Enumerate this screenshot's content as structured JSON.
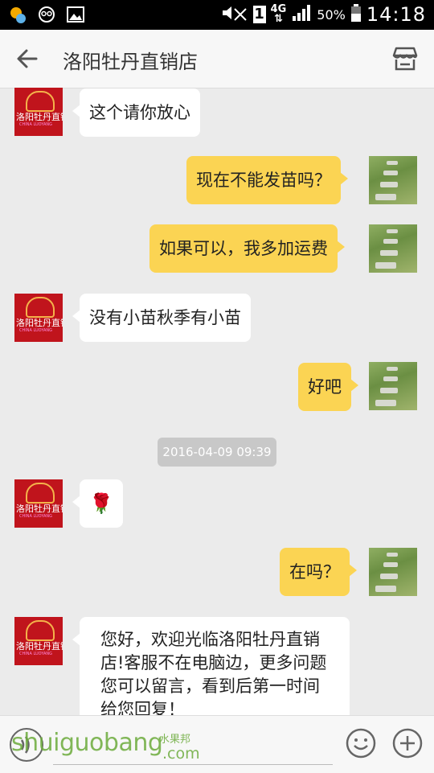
{
  "status_bar": {
    "network": "4G",
    "sim_slot": "1",
    "battery": "50%",
    "time": "14:18"
  },
  "app_bar": {
    "title": "洛阳牡丹直销店",
    "icons": {
      "back": "back-arrow-icon",
      "shop": "store-icon"
    }
  },
  "avatar_shop": {
    "logo_text": "洛阳牡丹直销店",
    "logo_en": "CHINA LUOYANG"
  },
  "messages": [
    {
      "side": "in",
      "text": "这个请你放心"
    },
    {
      "side": "out",
      "text": "现在不能发苗吗？"
    },
    {
      "side": "out",
      "text": "如果可以，我多加运费"
    },
    {
      "side": "in",
      "text": "没有小苗秋季有小苗"
    },
    {
      "side": "out",
      "text": "好吧"
    },
    {
      "side": "in",
      "text": "🌹"
    },
    {
      "side": "out",
      "text": "在吗？"
    },
    {
      "side": "in",
      "text": "您好，欢迎光临洛阳牡丹直销店!客服不在电脑边，更多问题您可以留言，看到后第一时间给您回复！"
    }
  ],
  "timestamp": "2016-04-09 09:39",
  "input_bar": {
    "icons": {
      "voice": "voice-icon",
      "emoji": "emoji-icon",
      "more": "plus-icon"
    }
  },
  "watermark": {
    "text": "shuiguobang",
    "domain": ".com",
    "chinese": "水果邦"
  },
  "colors": {
    "outgoing": "#fbd453",
    "incoming": "#ffffff",
    "background": "#ebebeb",
    "shop_avatar": "#c0141c"
  }
}
